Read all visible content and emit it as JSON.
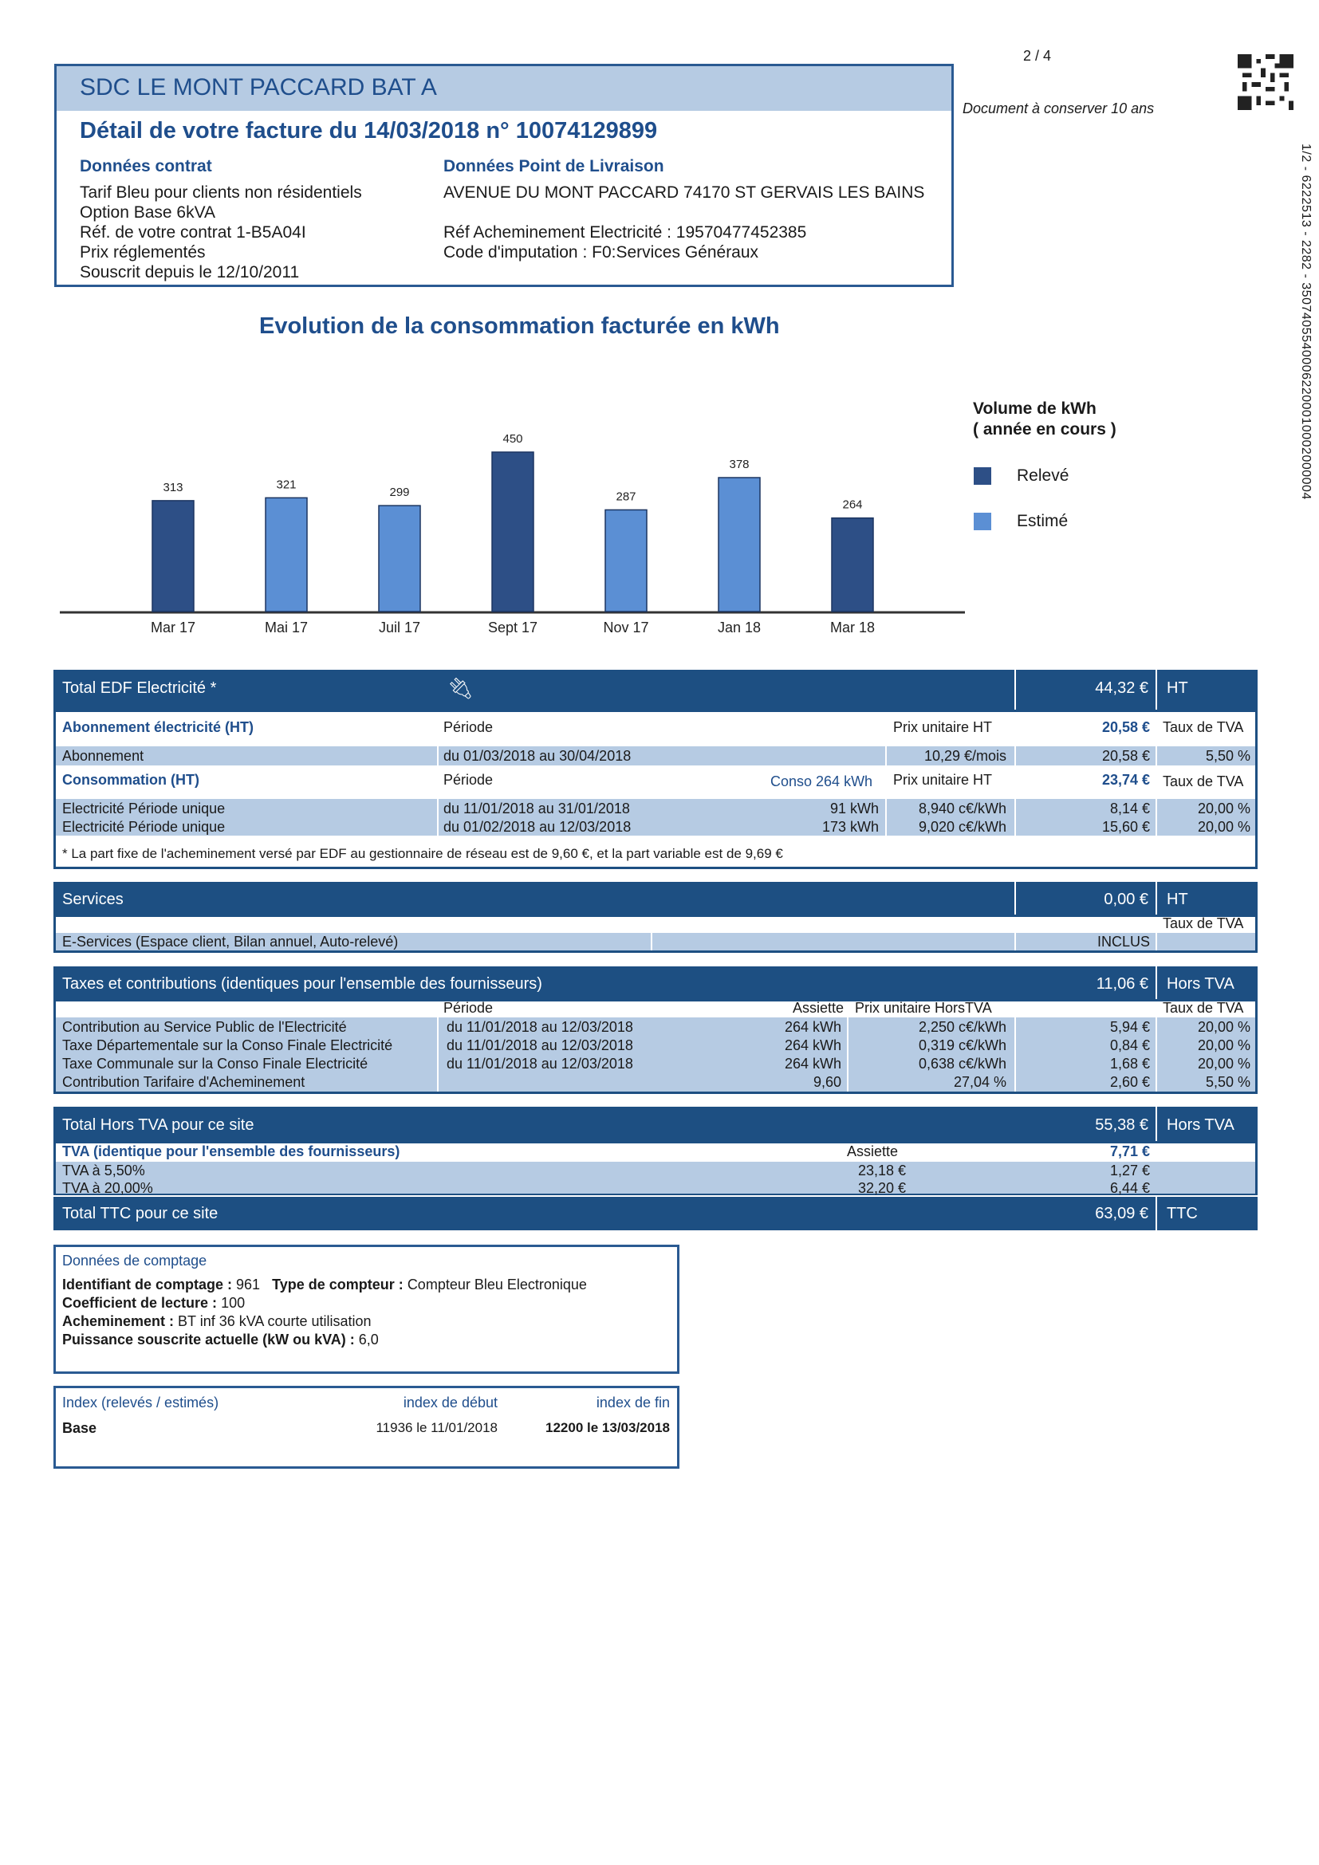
{
  "page": {
    "page_number": "2 / 4",
    "conserve_note": "Document à conserver 10 ans",
    "side_reference": "1/2 - 6222513 - 2282 - 35074055400062200010002000004"
  },
  "header": {
    "title": "SDC LE MONT PACCARD BAT A",
    "subtitle": "Détail de votre facture du 14/03/2018 n° 10074129899",
    "contract_label": "Données contrat",
    "contract_lines": [
      "Tarif Bleu pour clients non résidentiels",
      "Option Base 6kVA",
      "Réf. de votre contrat 1-B5A04I",
      "Prix réglementés",
      "Souscrit depuis le 12/10/2011"
    ],
    "delivery_label": "Données Point de Livraison",
    "delivery_address": "AVENUE DU MONT PACCARD 74170 ST GERVAIS LES BAINS",
    "delivery_ref": "Réf Acheminement Electricité : 19570477452385",
    "delivery_code": "Code d'imputation : F0:Services Généraux"
  },
  "chart_data": {
    "type": "bar",
    "title": "Evolution de la consommation facturée en kWh",
    "categories": [
      "Mar 17",
      "Mai 17",
      "Juil 17",
      "Sept 17",
      "Nov 17",
      "Jan 18",
      "Mar 18"
    ],
    "values": [
      313,
      321,
      299,
      450,
      287,
      378,
      264
    ],
    "value_labels": [
      "313",
      "321",
      "299",
      "450",
      "287",
      "378",
      "264"
    ],
    "bar_types": [
      "Relevé",
      "Estimé",
      "Estimé",
      "Relevé",
      "Estimé",
      "Estimé",
      "Relevé"
    ],
    "ylim": [
      0,
      450
    ],
    "legend_title_1": "Volume de kWh",
    "legend_title_2": "( année en cours )",
    "legend": [
      {
        "name": "Relevé",
        "color": "#2d4f86"
      },
      {
        "name": "Estimé",
        "color": "#5b8fd4"
      }
    ],
    "legend_placement": "right"
  },
  "edf": {
    "title": "Total EDF Electricité *",
    "total": "44,32 €",
    "unit": "HT",
    "abo_label": "Abonnement électricité (HT)",
    "periode_label": "Période",
    "prix_label": "Prix unitaire HT",
    "abo_total": "20,58 €",
    "tva_label": "Taux de TVA",
    "abo_row": {
      "label": "Abonnement",
      "periode": "du 01/03/2018 au 30/04/2018",
      "prix": "10,29 €/mois",
      "montant": "20,58 €",
      "tva": "5,50 %"
    },
    "conso_label": "Consommation (HT)",
    "conso_kwh": "Conso 264 kWh",
    "conso_total": "23,74 €",
    "conso_rows": [
      {
        "label": "Electricité Période unique",
        "periode": "du 11/01/2018 au 31/01/2018",
        "qte": "91 kWh",
        "prix": "8,940 c€/kWh",
        "montant": "8,14 €",
        "tva": "20,00 %"
      },
      {
        "label": "Electricité Période unique",
        "periode": "du 01/02/2018 au 12/03/2018",
        "qte": "173 kWh",
        "prix": "9,020 c€/kWh",
        "montant": "15,60 €",
        "tva": "20,00 %"
      }
    ],
    "footnote": "* La part fixe de l'acheminement versé par EDF au gestionnaire de réseau est de 9,60 €, et la part variable est de 9,69 €"
  },
  "services": {
    "title": "Services",
    "total": "0,00 €",
    "unit": "HT",
    "tva_label": "Taux de TVA",
    "row_label": "E-Services (Espace client, Bilan annuel, Auto-relevé)",
    "row_value": "INCLUS"
  },
  "taxes": {
    "title": "Taxes et contributions (identiques pour l'ensemble des fournisseurs)",
    "total": "11,06 €",
    "unit": "Hors TVA",
    "periode_label": "Période",
    "assiette_label": "Assiette",
    "prix_label": "Prix unitaire HorsTVA",
    "tva_label": "Taux de TVA",
    "rows": [
      {
        "label": "Contribution au Service Public de l'Electricité",
        "periode": "du 11/01/2018 au 12/03/2018",
        "assiette": "264 kWh",
        "prix": "2,250 c€/kWh",
        "montant": "5,94 €",
        "tva": "20,00 %"
      },
      {
        "label": "Taxe Départementale sur la Conso Finale Electricité",
        "periode": "du 11/01/2018 au 12/03/2018",
        "assiette": "264 kWh",
        "prix": "0,319 c€/kWh",
        "montant": "0,84 €",
        "tva": "20,00 %"
      },
      {
        "label": "Taxe Communale sur la Conso Finale Electricité",
        "periode": "du 11/01/2018 au 12/03/2018",
        "assiette": "264 kWh",
        "prix": "0,638 c€/kWh",
        "montant": "1,68 €",
        "tva": "20,00 %"
      },
      {
        "label": "Contribution Tarifaire d'Acheminement",
        "periode": "",
        "assiette": "9,60",
        "prix": "27,04 %",
        "montant": "2,60 €",
        "tva": "5,50 %"
      }
    ]
  },
  "totals": {
    "ht_label": "Total Hors TVA pour ce site",
    "ht_value": "55,38 €",
    "ht_unit": "Hors TVA",
    "tva_label": "TVA (identique pour l'ensemble des fournisseurs)",
    "assiette_label": "Assiette",
    "tva_total": "7,71 €",
    "tva_rows": [
      {
        "label": "TVA à 5,50%",
        "assiette": "23,18 €",
        "montant": "1,27 €"
      },
      {
        "label": "TVA à 20,00%",
        "assiette": "32,20 €",
        "montant": "6,44 €"
      }
    ],
    "ttc_label": "Total TTC pour ce site",
    "ttc_value": "63,09 €",
    "ttc_unit": "TTC"
  },
  "comptage": {
    "title": "Données de comptage",
    "id_label": "Identifiant de comptage :",
    "id_value": "961",
    "type_label": "Type de compteur :",
    "type_value": "Compteur Bleu Electronique",
    "coef_label": "Coefficient de lecture :",
    "coef_value": "100",
    "ach_label": "Acheminement :",
    "ach_value": "BT inf 36 kVA courte utilisation",
    "puiss_label": "Puissance souscrite actuelle (kW ou kVA) :",
    "puiss_value": "6,0"
  },
  "index": {
    "title": "Index (relevés / estimés)",
    "debut_label": "index de début",
    "fin_label": "index de fin",
    "row_label": "Base",
    "debut_value": "11936 le 11/01/2018",
    "fin_value": "12200 le 13/03/2018"
  }
}
